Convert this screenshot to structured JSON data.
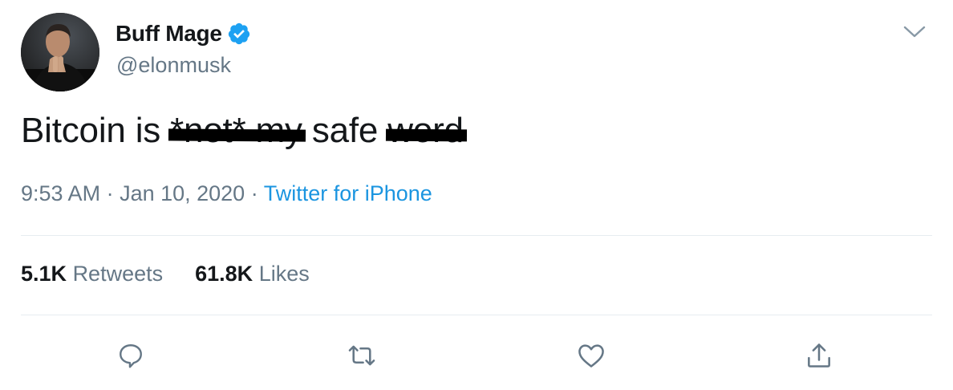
{
  "author": {
    "display_name": "Buff Mage",
    "handle": "@elonmusk",
    "verified": true,
    "avatar": "profile-photo"
  },
  "tweet": {
    "text_before": "Bitcoin is ",
    "struck_1": "*not* my",
    "text_middle": " safe ",
    "struck_2": "word"
  },
  "meta": {
    "time": "9:53 AM",
    "separator": " · ",
    "date": "Jan 10, 2020",
    "separator2": " · ",
    "source": "Twitter for iPhone"
  },
  "stats": {
    "retweets_count": "5.1K",
    "retweets_label": "Retweets",
    "likes_count": "61.8K",
    "likes_label": "Likes"
  },
  "colors": {
    "verified": "#1da1f2",
    "link": "#1b95e0",
    "secondary_text": "#657786",
    "divider": "#e6ecf0"
  },
  "icons": [
    "verified-badge-icon",
    "chevron-down-icon",
    "reply-icon",
    "retweet-icon",
    "like-icon",
    "share-icon"
  ]
}
